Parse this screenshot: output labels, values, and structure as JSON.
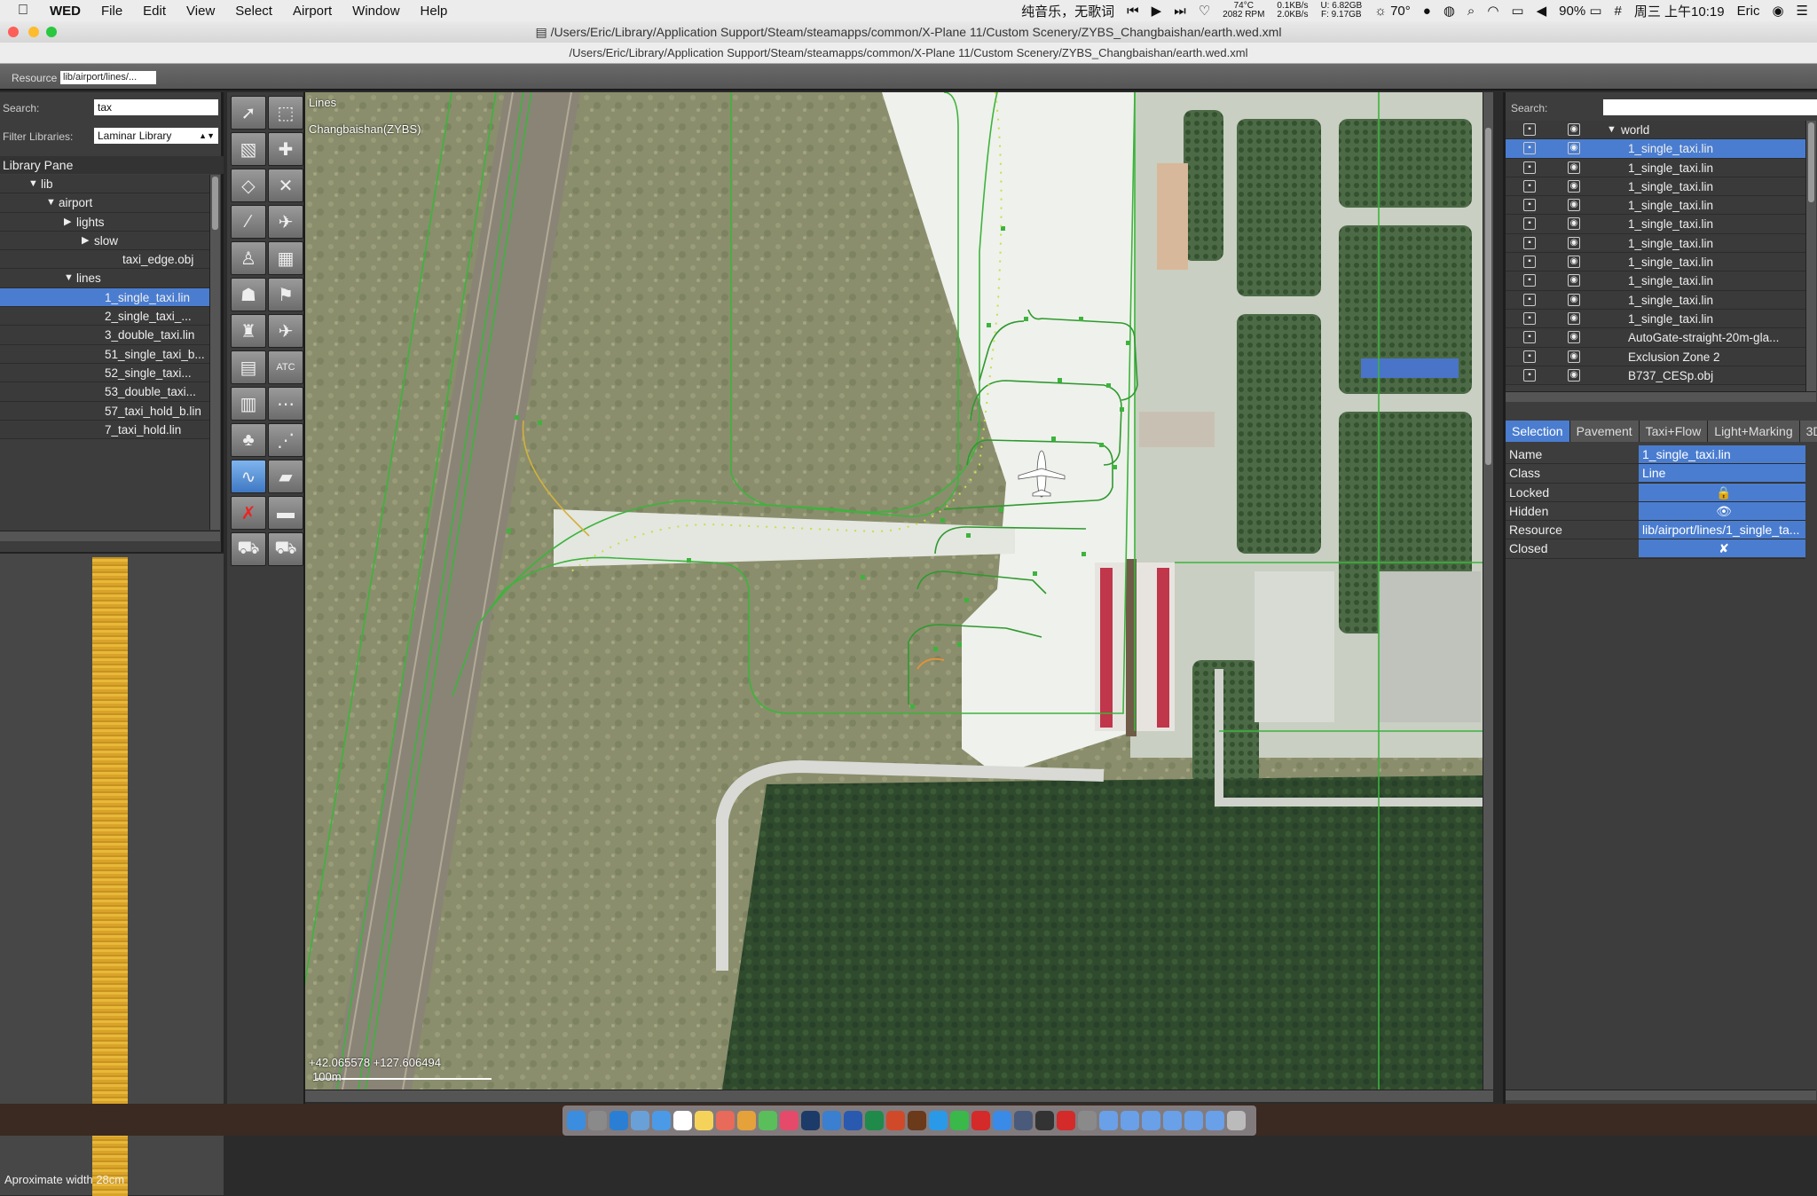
{
  "menubar": {
    "app_name": "WED",
    "menus": [
      "File",
      "Edit",
      "View",
      "Select",
      "Airport",
      "Window",
      "Help"
    ],
    "now_playing": "纯音乐，无歌词",
    "cpu_temp": "74°C",
    "fan_rpm": "2082 RPM",
    "net_up": "0.1KB/s",
    "net_down": "2.0KB/s",
    "mem_used": "U: 6.82GB",
    "mem_free": "F: 9.17GB",
    "weather": "70°",
    "battery": "90%",
    "clock": "周三 上午10:19",
    "user": "Eric"
  },
  "window": {
    "title": "/Users/Eric/Library/Application Support/Steam/steamapps/common/X-Plane 11/Custom Scenery/ZYBS_Changbaishan/earth.wed.xml",
    "subtitle": "/Users/Eric/Library/Application Support/Steam/steamapps/common/X-Plane 11/Custom Scenery/ZYBS_Changbaishan/earth.wed.xml"
  },
  "resource_bar": {
    "label": "Resource",
    "value": "lib/airport/lines/..."
  },
  "library": {
    "search_label": "Search:",
    "search_value": "tax",
    "filter_label": "Filter Libraries:",
    "filter_value": "Laminar Library",
    "pane_title": "Library Pane",
    "tree": [
      {
        "label": "lib",
        "indent": 1,
        "toggle": "open"
      },
      {
        "label": "airport",
        "indent": 2,
        "toggle": "open"
      },
      {
        "label": "lights",
        "indent": 3,
        "toggle": "closed"
      },
      {
        "label": "slow",
        "indent": 4,
        "toggle": "closed"
      },
      {
        "label": "taxi_edge.obj",
        "indent": 5,
        "toggle": ""
      },
      {
        "label": "lines",
        "indent": 3,
        "toggle": "open"
      },
      {
        "label": "1_single_taxi.lin",
        "indent": 4,
        "toggle": "",
        "selected": true
      },
      {
        "label": "2_single_taxi_...",
        "indent": 4,
        "toggle": ""
      },
      {
        "label": "3_double_taxi.lin",
        "indent": 4,
        "toggle": ""
      },
      {
        "label": "51_single_taxi_b...",
        "indent": 4,
        "toggle": ""
      },
      {
        "label": "52_single_taxi...",
        "indent": 4,
        "toggle": ""
      },
      {
        "label": "53_double_taxi...",
        "indent": 4,
        "toggle": ""
      },
      {
        "label": "57_taxi_hold_b.lin",
        "indent": 4,
        "toggle": ""
      },
      {
        "label": "7_taxi_hold.lin",
        "indent": 4,
        "toggle": ""
      }
    ],
    "preview_note": "Aproximate width 28cm"
  },
  "map": {
    "tool_label": "Lines",
    "airport_label": "Changbaishan(ZYBS)",
    "coords": "+42.065578 +127.606494",
    "scale_label": "100m"
  },
  "world": {
    "search_label": "Search:",
    "root_label": "world",
    "items": [
      {
        "label": "1_single_taxi.lin",
        "selected": true
      },
      {
        "label": "1_single_taxi.lin"
      },
      {
        "label": "1_single_taxi.lin"
      },
      {
        "label": "1_single_taxi.lin"
      },
      {
        "label": "1_single_taxi.lin"
      },
      {
        "label": "1_single_taxi.lin"
      },
      {
        "label": "1_single_taxi.lin"
      },
      {
        "label": "1_single_taxi.lin"
      },
      {
        "label": "1_single_taxi.lin"
      },
      {
        "label": "1_single_taxi.lin"
      },
      {
        "label": "AutoGate-straight-20m-gla..."
      },
      {
        "label": "Exclusion Zone 2"
      },
      {
        "label": "B737_CESp.obj"
      }
    ]
  },
  "tabs": [
    "Selection",
    "Pavement",
    "Taxi+Flow",
    "Light+Marking",
    "3D"
  ],
  "properties": [
    {
      "key": "Name",
      "value": "1_single_taxi.lin"
    },
    {
      "key": "Class",
      "value": "Line"
    },
    {
      "key": "Locked",
      "value": "🔒"
    },
    {
      "key": "Hidden",
      "value": "👁"
    },
    {
      "key": "Resource",
      "value": "lib/airport/lines/1_single_ta..."
    },
    {
      "key": "Closed",
      "value": "✘"
    }
  ],
  "colors": {
    "selection": "#4a7dd0",
    "line_green": "#3fb43f",
    "vertex_yellow": "#c6e04a"
  }
}
